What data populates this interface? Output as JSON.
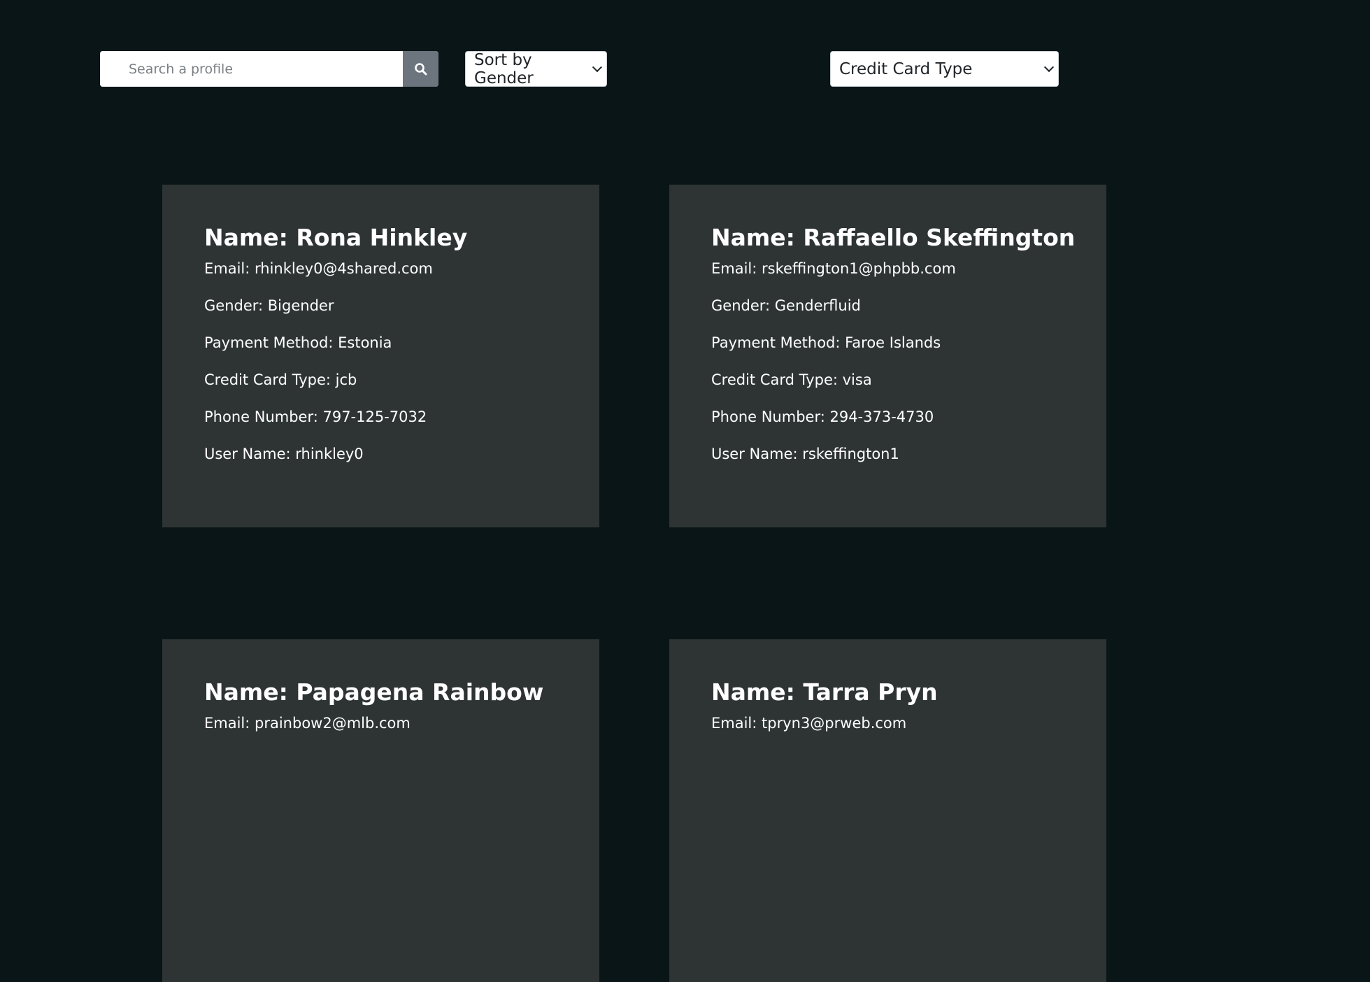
{
  "search": {
    "placeholder": "Search a profile",
    "button_icon": "search-icon"
  },
  "sort": {
    "selected": "Sort by Gender"
  },
  "credit_filter": {
    "selected": "Credit Card Type"
  },
  "colors": {
    "background": "#0a1517",
    "card": "#2e3434",
    "search_button": "#6c757d"
  },
  "profiles": [
    {
      "name": "Name: Rona Hinkley",
      "email": "Email: rhinkley0@4shared.com",
      "gender": "Gender: Bigender",
      "payment": "Payment Method: Estonia",
      "card_type": "Credit Card Type: jcb",
      "phone": "Phone Number: 797-125-7032",
      "username": "User Name: rhinkley0"
    },
    {
      "name": "Name: Raffaello Skeffington",
      "email": "Email: rskeffington1@phpbb.com",
      "gender": "Gender: Genderfluid",
      "payment": "Payment Method: Faroe Islands",
      "card_type": "Credit Card Type: visa",
      "phone": "Phone Number: 294-373-4730",
      "username": "User Name: rskeffington1"
    },
    {
      "name": "Name: Papagena Rainbow",
      "email": "Email: prainbow2@mlb.com"
    },
    {
      "name": "Name: Tarra Pryn",
      "email": "Email: tpryn3@prweb.com"
    }
  ]
}
